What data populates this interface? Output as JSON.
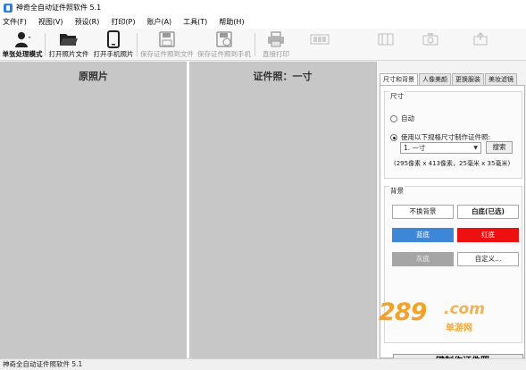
{
  "window": {
    "title": "神奇全自动证件照软件 5.1"
  },
  "menu": [
    "文件(F)",
    "视图(V)",
    "预设(R)",
    "打印(P)",
    "账户(A)",
    "工具(T)",
    "帮助(H)"
  ],
  "toolbar": {
    "single_mode": "单张处理模式",
    "open_photo": "打开照片文件",
    "open_phone": "打开手机照片",
    "save_file": "保存证件照到文件",
    "save_phone": "保存证件照到手机",
    "direct_print": "直接打印"
  },
  "panes": {
    "original_title": "原照片",
    "id_title": "证件照：一寸"
  },
  "tabs": [
    "尺寸和背景",
    "人像美颜",
    "更换服装",
    "美妆滤镜"
  ],
  "size": {
    "group_title": "尺寸",
    "auto_label": "自动",
    "custom_label": "使用以下规格尺寸制作证件照:",
    "selected_size": "1. 一寸",
    "search_label": "搜索",
    "description": "(295像素 x 413像素，25毫米 x 35毫米)"
  },
  "background": {
    "group_title": "背景",
    "keep_label": "不换背景",
    "white_label": "白底(已选)",
    "blue_label": "蓝底",
    "red_label": "红底",
    "gray_label": "灰底",
    "custom_label": "自定义..."
  },
  "make_button": "一键制作证件照",
  "status": "神奇全自动证件照软件 5.1",
  "watermark": {
    "number": "289",
    "domain": ".com",
    "sub": "单游网"
  },
  "colors": {
    "blue_bg": "#3d86d8",
    "red_bg": "#ee1010",
    "gray_bg": "#a5a5a5",
    "pane_bg": "#c7c7c7"
  }
}
